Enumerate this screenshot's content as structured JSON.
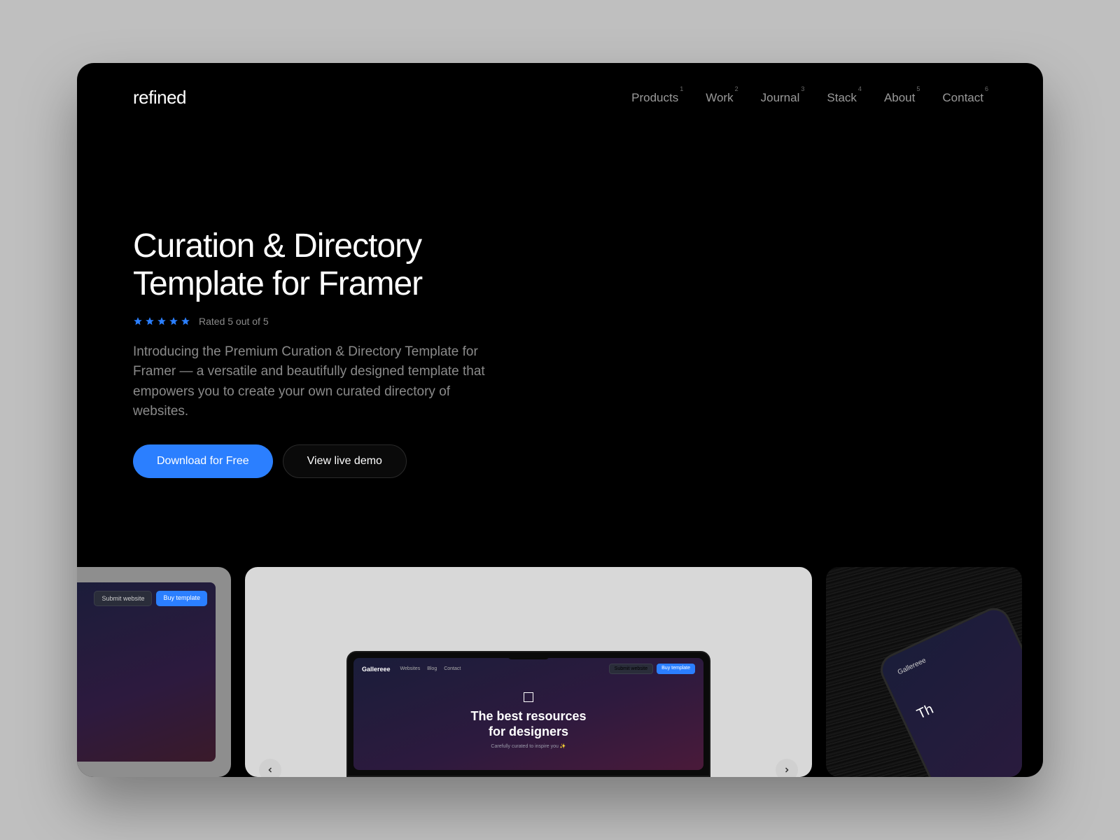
{
  "brand": "refined",
  "nav": [
    {
      "label": "Products",
      "num": "1"
    },
    {
      "label": "Work",
      "num": "2"
    },
    {
      "label": "Journal",
      "num": "3"
    },
    {
      "label": "Stack",
      "num": "4"
    },
    {
      "label": "About",
      "num": "5"
    },
    {
      "label": "Contact",
      "num": "6"
    }
  ],
  "hero": {
    "title": "Curation & Directory Template for Framer",
    "rating_text": "Rated 5 out of 5",
    "stars": 5,
    "description": "Introducing the Premium Curation & Directory Template for Framer — a versatile and beautifully designed template that empowers you to create your own curated directory of websites.",
    "primary_cta": "Download for Free",
    "secondary_cta": "View live demo"
  },
  "preview": {
    "mini_submit": "Submit website",
    "mini_buy": "Buy template",
    "laptop_brand": "Gallereee",
    "laptop_nav": [
      "Websites",
      "Blog",
      "Contact"
    ],
    "laptop_title_1": "The best resources",
    "laptop_title_2": "for designers",
    "laptop_sub": "Carefully curated to inspire you ✨",
    "phone_brand": "Gallereee",
    "phone_text": "Th"
  }
}
